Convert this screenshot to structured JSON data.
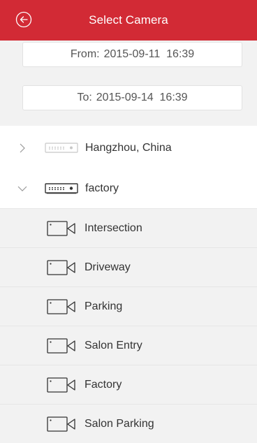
{
  "header": {
    "title": "Select Camera"
  },
  "date_range": {
    "from_label": "From:",
    "from_value": "2015-09-11  16:39",
    "to_label": "To:",
    "to_value": "2015-09-14  16:39"
  },
  "devices": [
    {
      "label": "Hangzhou, China",
      "expanded": false
    },
    {
      "label": "factory",
      "expanded": true
    }
  ],
  "cameras": [
    {
      "label": "Intersection"
    },
    {
      "label": "Driveway"
    },
    {
      "label": "Parking"
    },
    {
      "label": "Salon Entry"
    },
    {
      "label": "Factory"
    },
    {
      "label": "Salon Parking"
    }
  ],
  "colors": {
    "header_bg": "#d22a35",
    "row_child_bg": "#f2f2f2",
    "text": "#333333"
  }
}
